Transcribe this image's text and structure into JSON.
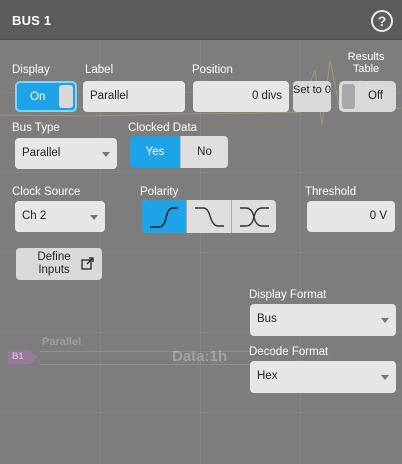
{
  "header": {
    "title": "BUS 1",
    "help_icon": "help-icon"
  },
  "display": {
    "label": "Display",
    "value": "On"
  },
  "label_field": {
    "label": "Label",
    "value": "Parallel"
  },
  "position": {
    "label": "Position",
    "value": "0 divs",
    "set_button": "Set to 0"
  },
  "results_table": {
    "label": "Results Table",
    "value": "Off"
  },
  "bus_type": {
    "label": "Bus Type",
    "value": "Parallel"
  },
  "clocked_data": {
    "label": "Clocked Data",
    "options": [
      "Yes",
      "No"
    ],
    "selected": "Yes"
  },
  "clock_source": {
    "label": "Clock Source",
    "value": "Ch 2"
  },
  "polarity": {
    "label": "Polarity",
    "options": [
      "rising-edge-icon",
      "falling-edge-icon",
      "either-edge-icon"
    ],
    "selected": "rising-edge-icon"
  },
  "threshold": {
    "label": "Threshold",
    "value": "0 V"
  },
  "define_inputs": {
    "label": "Define Inputs",
    "icon": "external-link-icon"
  },
  "display_format": {
    "label": "Display Format",
    "value": "Bus"
  },
  "decode_format": {
    "label": "Decode Format",
    "value": "Hex"
  },
  "background": {
    "bus_marker": "B1",
    "bus_name": "Parallel",
    "bus_data": "Data:1h"
  },
  "colors": {
    "accent": "#1ea3e6",
    "panel": "#7d7d7d",
    "header": "#5b5b5b",
    "field": "#e6e6e6"
  }
}
